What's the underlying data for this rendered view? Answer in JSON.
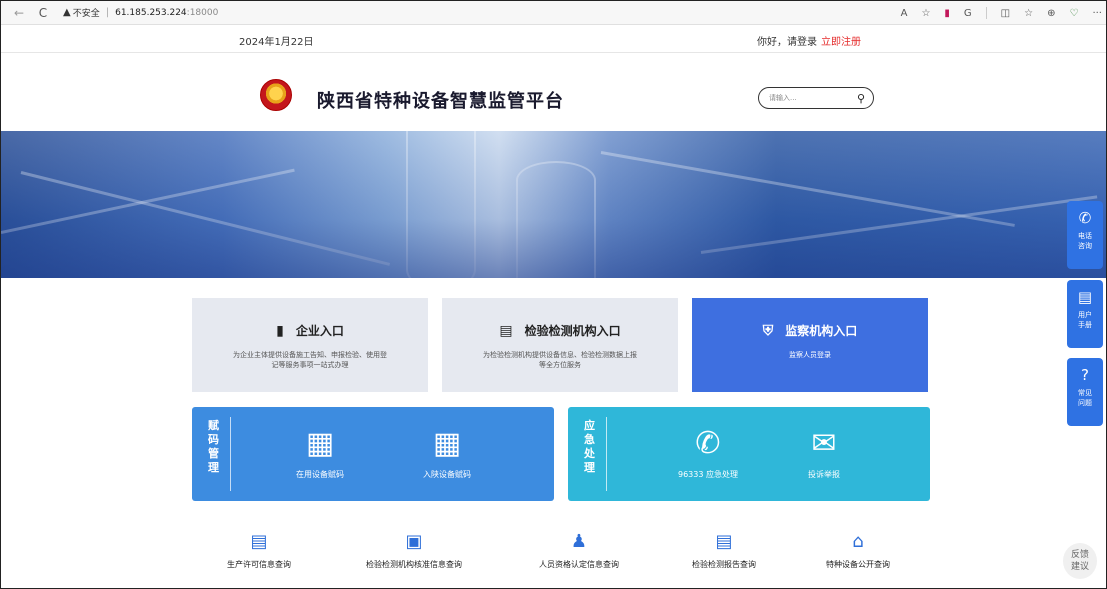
{
  "browser": {
    "back": "←",
    "reload": "C",
    "warning_icon": "▲",
    "insecure_label": "不安全",
    "url_host": "61.185.253.224",
    "url_port": ":18000",
    "actions": [
      "A",
      "☆",
      "▮",
      "G",
      "◫",
      "☆",
      "⊕",
      "♡",
      "···"
    ]
  },
  "topbar": {
    "date": "2024年1月22日",
    "greeting": "你好，请登录",
    "register": "立即注册"
  },
  "header": {
    "title": "陕西省特种设备智慧监管平台",
    "search_placeholder": "请输入..."
  },
  "entries": [
    {
      "title": "企业入口",
      "desc": "为企业主体提供设备施工告知、申报检验、使用登记等服务事项一站式办理"
    },
    {
      "title": "检验检测机构入口",
      "desc": "为检验检测机构提供设备信息、检验检测数据上报等全方位服务"
    },
    {
      "title": "监察机构入口",
      "desc": "监察人员登录"
    }
  ],
  "panels": {
    "code_mgmt": {
      "label": "赋码管理",
      "items": [
        {
          "label": "在用设备赋码"
        },
        {
          "label": "入陕设备赋码"
        }
      ]
    },
    "emergency": {
      "label": "应急处理",
      "items": [
        {
          "label": "96333 应急处理"
        },
        {
          "label": "投诉举报"
        }
      ]
    }
  },
  "queries": [
    "生产许可信息查询",
    "检验检测机构核准信息查询",
    "人员资格认定信息查询",
    "检验检测报告查询",
    "特种设备公开查询"
  ],
  "side_buttons": [
    {
      "icon": "phone-icon",
      "label1": "电话",
      "label2": "咨询"
    },
    {
      "icon": "manual-icon",
      "label1": "用户",
      "label2": "手册"
    },
    {
      "icon": "question-icon",
      "label1": "常见",
      "label2": "问题"
    }
  ],
  "feedback": {
    "line1": "反馈",
    "line2": "建议"
  },
  "colors": {
    "accent_blue": "#3e6fe0",
    "panel_blue": "#3d8ce0",
    "panel_cyan": "#2fb7d9",
    "register_red": "#e52b2b"
  }
}
